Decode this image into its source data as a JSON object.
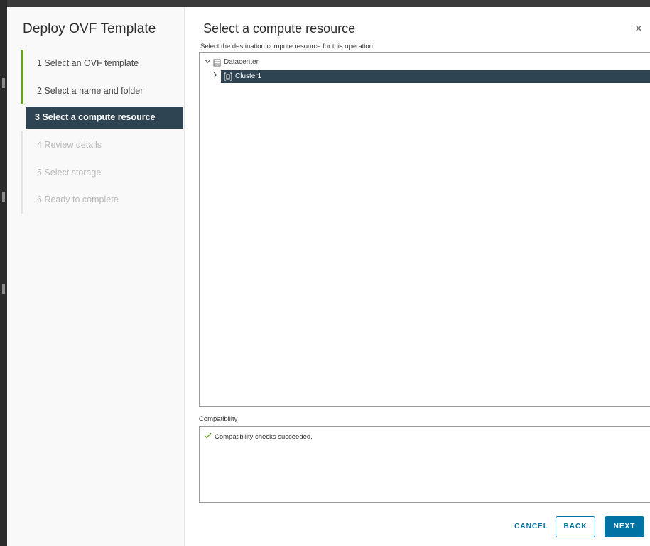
{
  "wizard": {
    "title": "Deploy OVF Template",
    "steps": [
      {
        "label": "1  Select an OVF template",
        "state": "done"
      },
      {
        "label": "2  Select a name and folder",
        "state": "done"
      },
      {
        "label": "3  Select a compute resource",
        "state": "active"
      },
      {
        "label": "4  Review details",
        "state": "disabled"
      },
      {
        "label": "5  Select storage",
        "state": "disabled"
      },
      {
        "label": "6  Ready to complete",
        "state": "disabled"
      }
    ]
  },
  "page": {
    "title": "Select a compute resource",
    "close_glyph": "×",
    "instruction": "Select the destination compute resource for this operation"
  },
  "tree": {
    "nodes": [
      {
        "label": "Datacenter",
        "icon": "datacenter-icon",
        "expanded": true
      },
      {
        "label": "Cluster1",
        "icon": "cluster-icon",
        "expanded": false,
        "selected": true
      }
    ]
  },
  "compatibility": {
    "label": "Compatibility",
    "message": "Compatibility checks succeeded.",
    "status_icon": "check-icon"
  },
  "footer": {
    "cancel_label": "CANCEL",
    "back_label": "BACK",
    "next_label": "NEXT"
  },
  "colors": {
    "accent": "#0072a3",
    "nav_active": "#2f4453",
    "done_marker": "#62a420"
  }
}
